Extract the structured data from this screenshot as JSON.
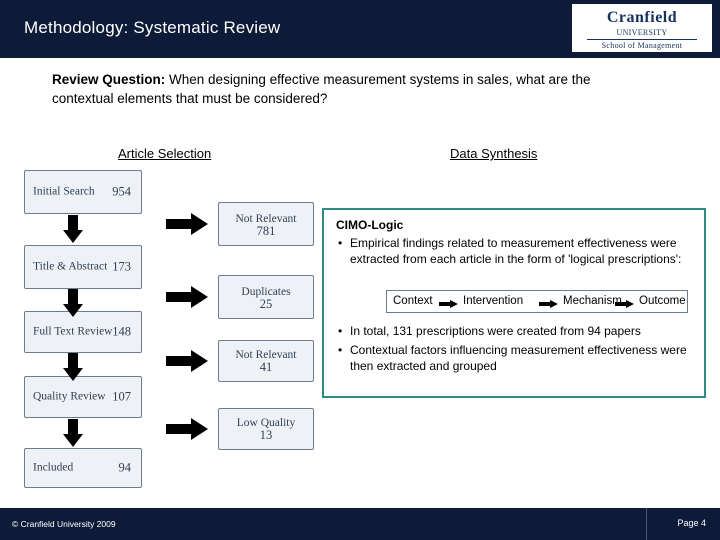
{
  "header": {
    "title": "Methodology: Systematic Review",
    "logo_name": "Cranfield",
    "logo_university": "UNIVERSITY",
    "logo_sub": "School of Management"
  },
  "question": {
    "label": "Review Question:",
    "text": " When designing effective measurement systems in sales, what are the contextual elements that must be considered?"
  },
  "sections": {
    "article_selection": "Article Selection",
    "data_synthesis": "Data Synthesis"
  },
  "flow": {
    "stages": [
      {
        "label": "Initial Search",
        "count": "954"
      },
      {
        "label": "Title & Abstract",
        "count": "173"
      },
      {
        "label": "Full Text Review",
        "count": "148"
      },
      {
        "label": "Quality Review",
        "count": "107"
      },
      {
        "label": "Included",
        "count": "94"
      }
    ],
    "exclusions": [
      {
        "label": "Not Relevant",
        "count": "781"
      },
      {
        "label": "Duplicates",
        "count": "25"
      },
      {
        "label": "Not Relevant",
        "count": "41"
      },
      {
        "label": "Low Quality",
        "count": "13"
      }
    ]
  },
  "synthesis": {
    "heading": "CIMO-Logic",
    "bullet1": "Empirical findings related to measurement effectiveness were extracted from each article in the form of 'logical prescriptions':",
    "chain": {
      "context": "Context",
      "intervention": "Intervention",
      "mechanism": "Mechanism",
      "outcome": "Outcome"
    },
    "bullet2": "In total, 131 prescriptions were created from 94 papers",
    "bullet3": "Contextual factors influencing measurement effectiveness were then extracted and grouped",
    "bullet_char": "•"
  },
  "footer": {
    "copyright": "© Cranfield University 2009",
    "page": "Page 4"
  },
  "colors": {
    "header_bg": "#0d1b38",
    "panel_border": "#2e8b86",
    "box_border": "#6f7c8f",
    "box_fill": "#eef2f7"
  }
}
